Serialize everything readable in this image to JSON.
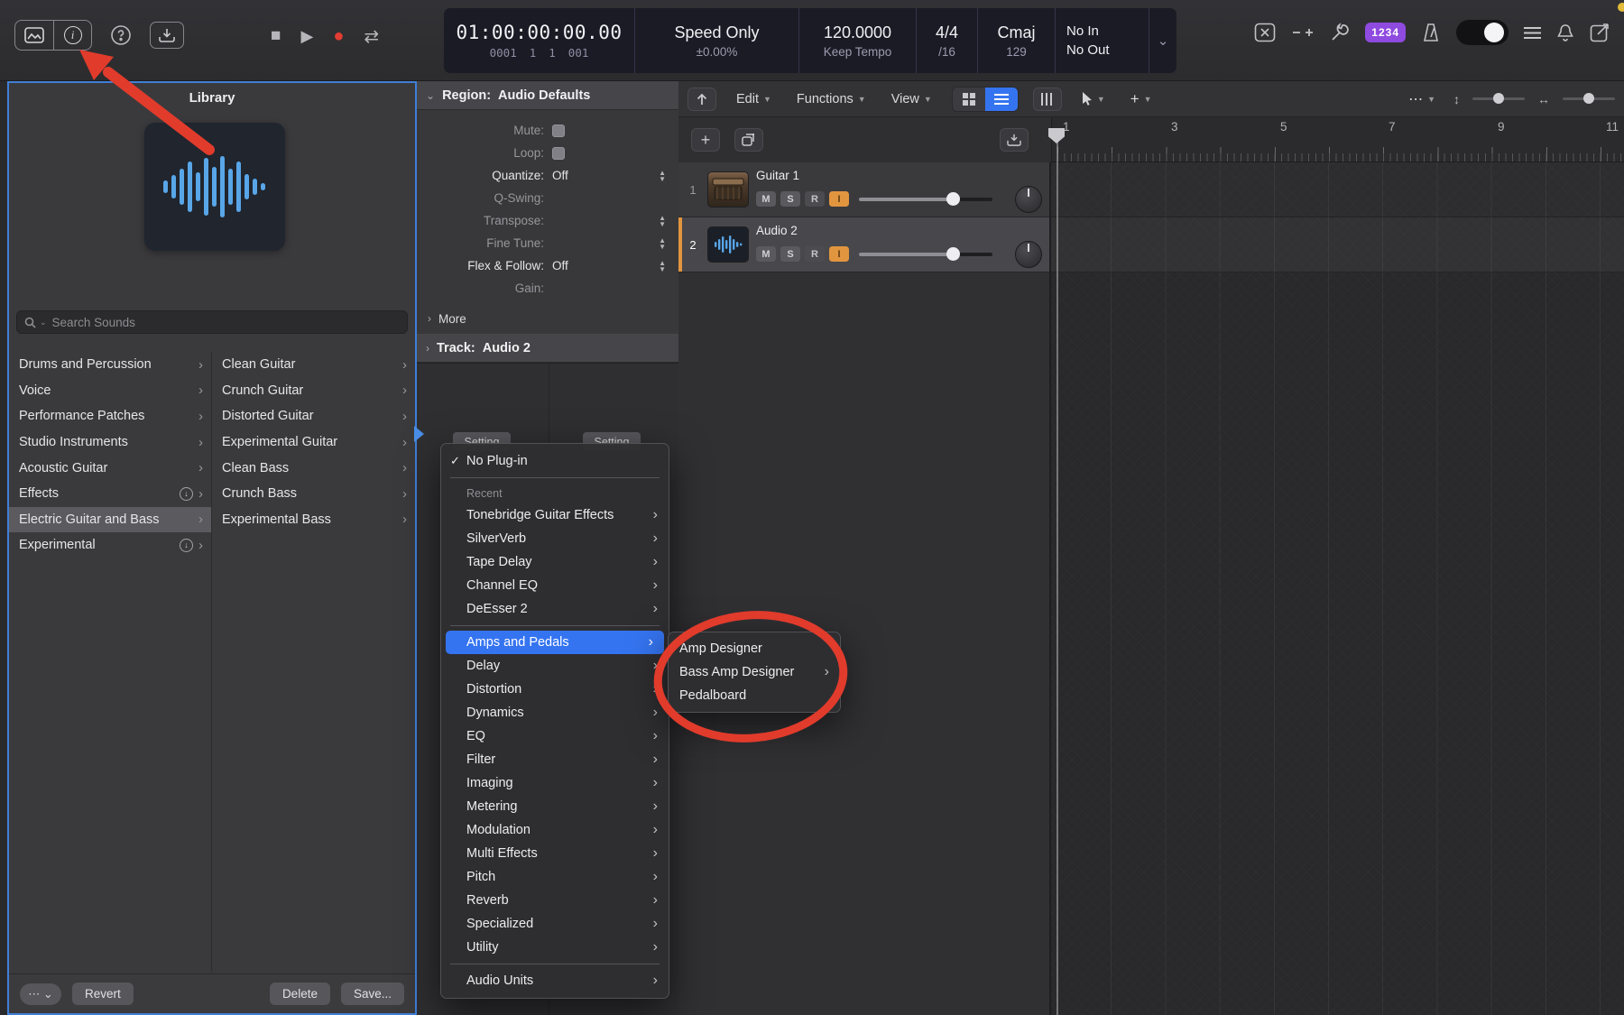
{
  "toolbar": {
    "lcd": {
      "time": "01:00:00:00.00",
      "position": [
        "0001",
        "1",
        "1",
        "001"
      ],
      "mode_label": "Speed Only",
      "mode_value": "±0.00%",
      "tempo": "120.0000",
      "tempo_mode": "Keep Tempo",
      "signature": "4/4",
      "division": "/16",
      "key": "Cmaj",
      "key_num": "129",
      "io_in": "No In",
      "io_out": "No Out"
    },
    "counter_badge": "1234"
  },
  "library": {
    "title": "Library",
    "search_placeholder": "Search Sounds",
    "categories": [
      {
        "label": "Drums and Percussion"
      },
      {
        "label": "Voice"
      },
      {
        "label": "Performance Patches"
      },
      {
        "label": "Studio Instruments"
      },
      {
        "label": "Acoustic Guitar"
      },
      {
        "label": "Effects"
      },
      {
        "label": "Electric Guitar and Bass"
      },
      {
        "label": "Experimental"
      }
    ],
    "subcategories": [
      {
        "label": "Clean Guitar"
      },
      {
        "label": "Crunch Guitar"
      },
      {
        "label": "Distorted Guitar"
      },
      {
        "label": "Experimental Guitar"
      },
      {
        "label": "Clean Bass"
      },
      {
        "label": "Crunch Bass"
      },
      {
        "label": "Experimental Bass"
      }
    ],
    "revert_label": "Revert",
    "delete_label": "Delete",
    "save_label": "Save..."
  },
  "inspector": {
    "region_label": "Region:",
    "region_value": "Audio Defaults",
    "fields": {
      "mute": "Mute:",
      "loop": "Loop:",
      "quantize": "Quantize:",
      "quantize_value": "Off",
      "qswing": "Q-Swing:",
      "transpose": "Transpose:",
      "fine_tune": "Fine Tune:",
      "flex": "Flex & Follow:",
      "flex_value": "Off",
      "gain": "Gain:",
      "more": "More"
    },
    "track_label": "Track:",
    "track_value": "Audio 2",
    "setting": "Setting"
  },
  "plugin_menu": {
    "no_plugin": "No Plug-in",
    "recent": "Recent",
    "recent_items": [
      "Tonebridge Guitar Effects",
      "SilverVerb",
      "Tape Delay",
      "Channel EQ",
      "DeEsser 2"
    ],
    "categories": [
      "Amps and Pedals",
      "Delay",
      "Distortion",
      "Dynamics",
      "EQ",
      "Filter",
      "Imaging",
      "Metering",
      "Modulation",
      "Multi Effects",
      "Pitch",
      "Reverb",
      "Specialized",
      "Utility"
    ],
    "audio_units": "Audio Units"
  },
  "submenu": {
    "items": [
      {
        "label": "Amp Designer"
      },
      {
        "label": "Bass Amp Designer"
      },
      {
        "label": "Pedalboard"
      }
    ]
  },
  "track_area": {
    "menu_edit": "Edit",
    "menu_functions": "Functions",
    "menu_view": "View",
    "controls": {
      "mute": "M",
      "solo": "S",
      "record": "R",
      "input": "I"
    },
    "tracks": [
      {
        "num": "1",
        "name": "Guitar 1"
      },
      {
        "num": "2",
        "name": "Audio 2"
      }
    ],
    "ruler": [
      "1",
      "3",
      "5",
      "7",
      "9",
      "11"
    ]
  },
  "colors": {
    "accent_blue": "#3574f0",
    "annotation_red": "#e13b2c",
    "selected_orange": "#e2953f",
    "badge_purple": "#8f4ae0"
  }
}
